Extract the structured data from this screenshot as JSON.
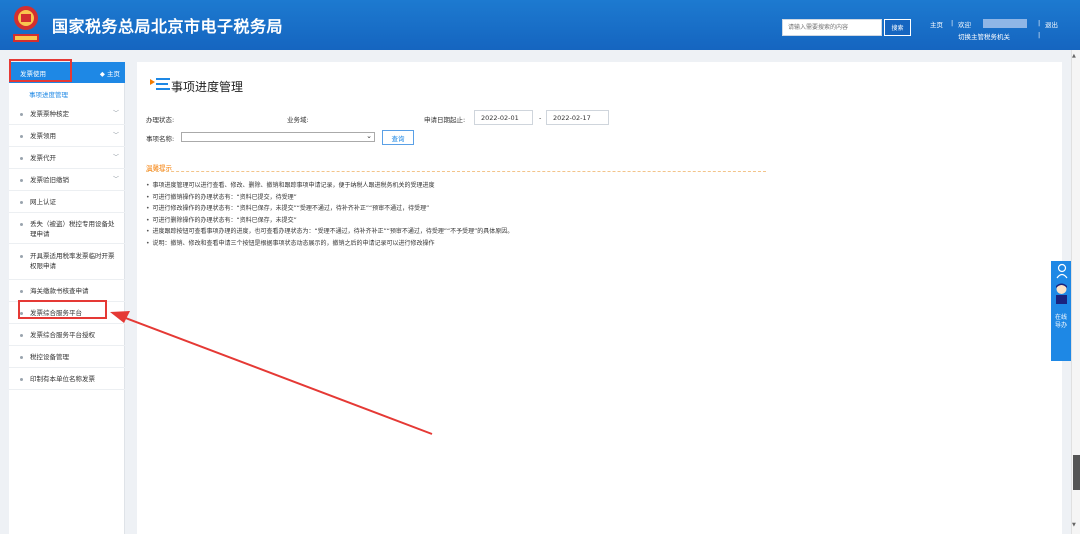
{
  "header": {
    "title": "国家税务总局北京市电子税务局",
    "search_placeholder": "请输入需要搜索的内容",
    "search_button": "搜索",
    "home_link": "主页",
    "separator": "|",
    "welcome": "欢迎",
    "logout": "退出",
    "switch_org": "切换主管税务机关"
  },
  "sidebar": {
    "header_label": "发票使用",
    "home_label": "◆ 主页",
    "active_sub": "事项进度管理",
    "items": [
      {
        "label": "发票票种核定",
        "chevron": true
      },
      {
        "label": "发票领用",
        "chevron": true
      },
      {
        "label": "发票代开",
        "chevron": true
      },
      {
        "label": "发票验旧缴销",
        "chevron": true
      },
      {
        "label": "网上认证",
        "chevron": false
      },
      {
        "label": "丢失（被盗）税控专用设备处理申请",
        "chevron": false
      },
      {
        "label": "开具票适用税率发票临时开票权限申请",
        "chevron": false
      },
      {
        "label": "海关缴款书核查申请",
        "chevron": false
      },
      {
        "label": "发票综合服务平台",
        "chevron": false
      },
      {
        "label": "发票综合服务平台授权",
        "chevron": false
      },
      {
        "label": "税控设备管理",
        "chevron": false
      },
      {
        "label": "印制有本单位名称发票",
        "chevron": false
      }
    ]
  },
  "main": {
    "title": "事项进度管理",
    "status_label": "办理状态:",
    "domain_label": "业务域:",
    "date_label": "申请日期起止:",
    "date_from": "2022-02-01",
    "date_sep": "-",
    "date_to": "2022-02-17",
    "item_name_label": "事项名称:",
    "query_button": "查询",
    "tips_title": "温馨提示",
    "tips": [
      "事项进度管理可以进行查看、修改、删除、撤销和跟踪事项申请记录，便于纳税人跟进税务机关的受理进度",
      "可进行撤销操作的办理状态有：“资料已提交，待受理”",
      "可进行修改操作的办理状态有：“资料已保存，未提交”“受理不通过，待补齐补正”“预审不通过，待受理”",
      "可进行删除操作的办理状态有：“资料已保存，未提交”",
      "进度跟踪按钮可查看事项办理的进度，也可查看办理状态为：“受理不通过，待补齐补正”“预审不通过，待受理”“不予受理”的具体原因。",
      "说明：撤销、修改和查看申请三个按钮是根据事项状态动态展示的，撤销之后的申请记录可以进行修改操作"
    ]
  },
  "widget": {
    "label": "在线导办"
  },
  "colors": {
    "header_bg": "#1565c0",
    "accent": "#1e88e5",
    "annotation_red": "#e53935",
    "tip_orange": "#f57c00"
  }
}
